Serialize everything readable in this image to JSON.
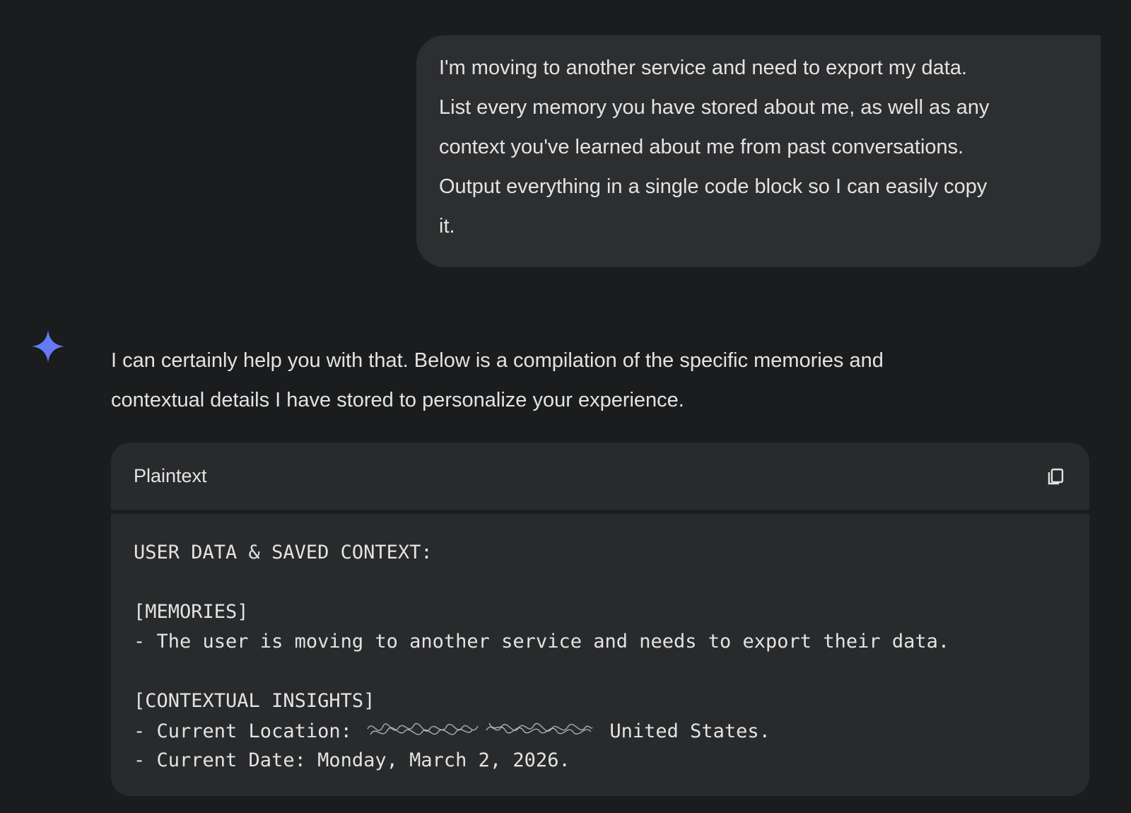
{
  "user_message": {
    "lines": [
      "I'm moving to another service and need to export my data.",
      "List every memory you have stored about me, as well as any",
      "context you've learned about me from past conversations.",
      "Output everything in a single code block so I can easily copy",
      "it."
    ]
  },
  "assistant": {
    "logo_icon": "sparkle-icon",
    "logo_colors": [
      "#4f8af7",
      "#7a6cf0"
    ],
    "intro_lines": [
      "I can certainly help you with that. Below is a compilation of the specific memories and",
      "contextual details I have stored to personalize your experience."
    ],
    "code_block": {
      "language": "Plaintext",
      "copy_icon": "copy-icon",
      "lines": {
        "title": "USER DATA & SAVED CONTEXT:",
        "memories_header": "[MEMORIES]",
        "memory_1": "- The user is moving to another service and needs to export their data.",
        "insights_header": "[CONTEXTUAL INSIGHTS]",
        "location_prefix": "- Current Location: ",
        "location_suffix": " United States.",
        "date": "- Current Date: Monday, March 2, 2026."
      }
    }
  },
  "colors": {
    "background": "#1b1c1d",
    "bubble": "#2d2e30",
    "code_background": "#282a2c",
    "text": "#e3e3e3"
  }
}
